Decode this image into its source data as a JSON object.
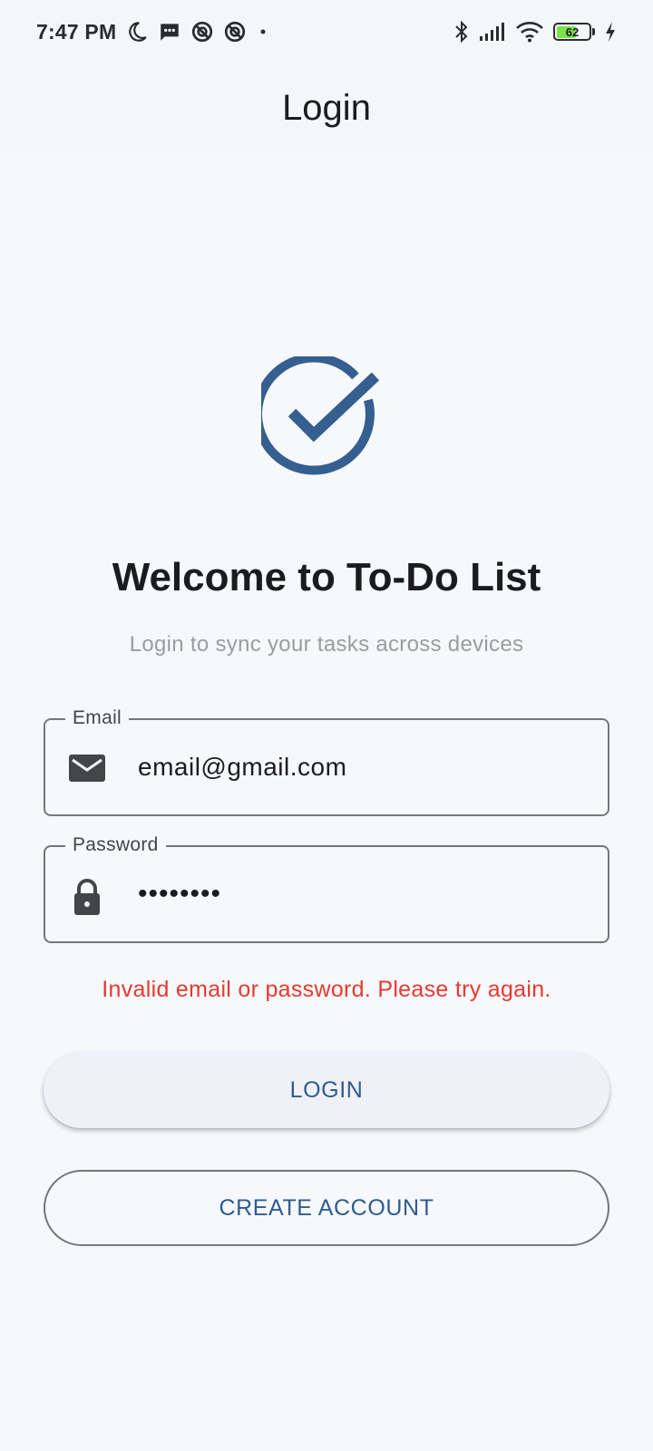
{
  "status_bar": {
    "time": "7:47 PM",
    "battery_level": "62",
    "icons_left": [
      "moon-icon",
      "message-icon",
      "no-disturb-icon",
      "no-disturb-icon",
      "dot-icon"
    ],
    "icons_right": [
      "bluetooth-icon",
      "signal-icon",
      "wifi-icon",
      "battery-icon",
      "charging-icon"
    ]
  },
  "app_bar": {
    "title": "Login"
  },
  "main": {
    "logo_icon": "check-circle-icon",
    "welcome_title": "Welcome to To-Do List",
    "subtitle": "Login to sync your tasks across devices",
    "email_field": {
      "label": "Email",
      "value": "email@gmail.com",
      "icon": "mail-icon"
    },
    "password_field": {
      "label": "Password",
      "value": "••••••••",
      "icon": "lock-icon"
    },
    "error_message": "Invalid email or password. Please try again.",
    "login_button": "LOGIN",
    "create_account_button": "CREATE ACCOUNT"
  },
  "colors": {
    "primary": "#345f90",
    "background": "#f7f8fc",
    "error": "#e33b2f",
    "outline": "#76777d",
    "battery_fill": "#7ee04a"
  }
}
